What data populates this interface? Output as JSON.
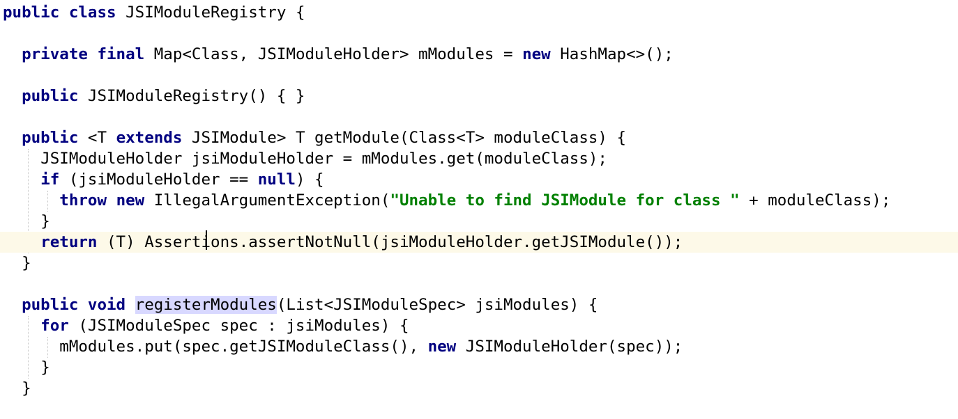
{
  "editor": {
    "language": "Java",
    "current_line": 11,
    "lines": [
      "public class JSIModuleRegistry {",
      "",
      "  private final Map<Class, JSIModuleHolder> mModules = new HashMap<>();",
      "",
      "  public JSIModuleRegistry() { }",
      "",
      "  public <T extends JSIModule> T getModule(Class<T> moduleClass) {",
      "    JSIModuleHolder jsiModuleHolder = mModules.get(moduleClass);",
      "    if (jsiModuleHolder == null) {",
      "      throw new IllegalArgumentException(\"Unable to find JSIModule for class \" + moduleClass);",
      "    }",
      "    return (T) Assertions.assertNotNull(jsiModuleHolder.getJSIModule());",
      "  }",
      "",
      "  public void registerModules(List<JSIModuleSpec> jsiModules) {",
      "    for (JSIModuleSpec spec : jsiModules) {",
      "      mModules.put(spec.getJSIModuleClass(), new JSIModuleHolder(spec));",
      "    }",
      "  }"
    ],
    "colors": {
      "keyword": "#000080",
      "string": "#008000",
      "current_line_bg": "#fdf9e8",
      "identifier_highlight": "#d8d8ff",
      "background": "#ffffff"
    },
    "highlighted_identifier": "registerModules"
  },
  "code": {
    "l1": {
      "kw1": "public",
      "kw2": "class",
      "name": "JSIModuleRegistry",
      "rest": " {"
    },
    "l3": {
      "kw1": "private",
      "kw2": "final",
      "t1": " Map<Class, JSIModuleHolder> mModules = ",
      "kw3": "new",
      "t2": " HashMap<>();"
    },
    "l5": {
      "kw1": "public",
      "t1": " JSIModuleRegistry() { }"
    },
    "l7": {
      "kw1": "public",
      "t1": " <T ",
      "kw2": "extends",
      "t2": " JSIModule> T getModule(Class<T> moduleClass) {"
    },
    "l8": {
      "t1": "JSIModuleHolder jsiModuleHolder = mModules.get(moduleClass);"
    },
    "l9": {
      "kw1": "if",
      "t1": " (jsiModuleHolder == ",
      "kw2": "null",
      "t2": ") {"
    },
    "l10": {
      "kw1": "throw",
      "kw2": "new",
      "t1": " IllegalArgumentException(",
      "str": "\"Unable to find JSIModule for class \"",
      "t2": " + moduleClass);"
    },
    "l11": {
      "t1": "}"
    },
    "l12": {
      "kw1": "return",
      "t1": " (T) Assertions.assertNotNull(jsiModuleHolder.getJSIModule());"
    },
    "l13": {
      "t1": "}"
    },
    "l15": {
      "kw1": "public",
      "kw2": "void",
      "hl": "registerModules",
      "t1": "(List<JSIModuleSpec> jsiModules) {"
    },
    "l16": {
      "kw1": "for",
      "t1": " (JSIModuleSpec spec : jsiModules) {"
    },
    "l17": {
      "t1": "mModules.put(spec.getJSIModuleClass(), ",
      "kw1": "new",
      "t2": " JSIModuleHolder(spec));"
    },
    "l18": {
      "t1": "}"
    },
    "l19": {
      "t1": "}"
    }
  }
}
